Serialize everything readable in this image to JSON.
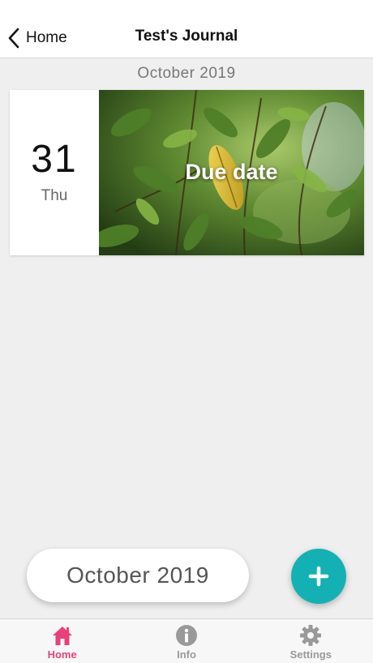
{
  "navbar": {
    "back_label": "Home",
    "title": "Test's Journal"
  },
  "section": {
    "header": "October 2019"
  },
  "entry": {
    "day": "31",
    "weekday": "Thu",
    "caption": "Due date",
    "photo_icon": "leaf-photo"
  },
  "month_selector": {
    "label": "October 2019"
  },
  "fab": {
    "icon": "plus-icon",
    "color": "#14b1b4"
  },
  "tabs": [
    {
      "label": "Home",
      "icon": "home-icon",
      "active": true
    },
    {
      "label": "Info",
      "icon": "info-icon",
      "active": false
    },
    {
      "label": "Settings",
      "icon": "gear-icon",
      "active": false
    }
  ],
  "colors": {
    "active_tab": "#e8407a",
    "inactive_tab": "#999999",
    "accent": "#14b1b4"
  }
}
